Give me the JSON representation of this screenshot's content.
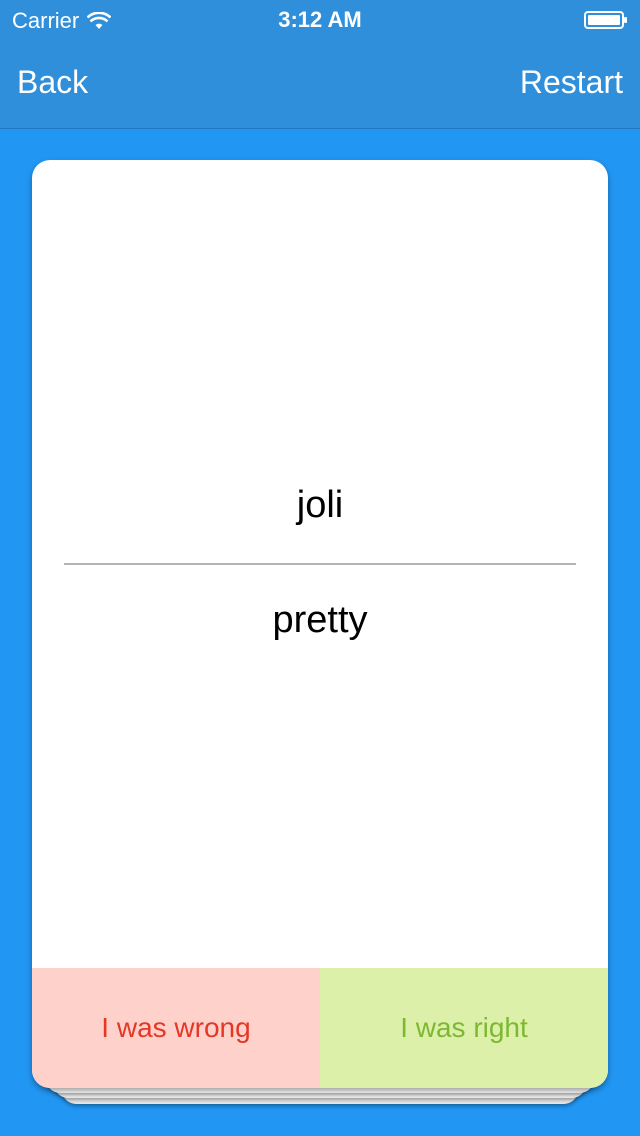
{
  "status_bar": {
    "carrier": "Carrier",
    "time": "3:12 AM",
    "wifi_icon": "wifi-icon",
    "battery_icon": "battery-icon"
  },
  "nav": {
    "back_label": "Back",
    "restart_label": "Restart"
  },
  "card": {
    "front_text": "joli",
    "back_text": "pretty"
  },
  "answers": {
    "wrong_label": "I was wrong",
    "right_label": "I was right"
  },
  "colors": {
    "background": "#2196F3",
    "nav_bar": "#2F8FDB",
    "wrong_bg": "#FFD1CB",
    "wrong_text": "#E53725",
    "right_bg": "#DDF0A9",
    "right_text": "#7DB832"
  }
}
